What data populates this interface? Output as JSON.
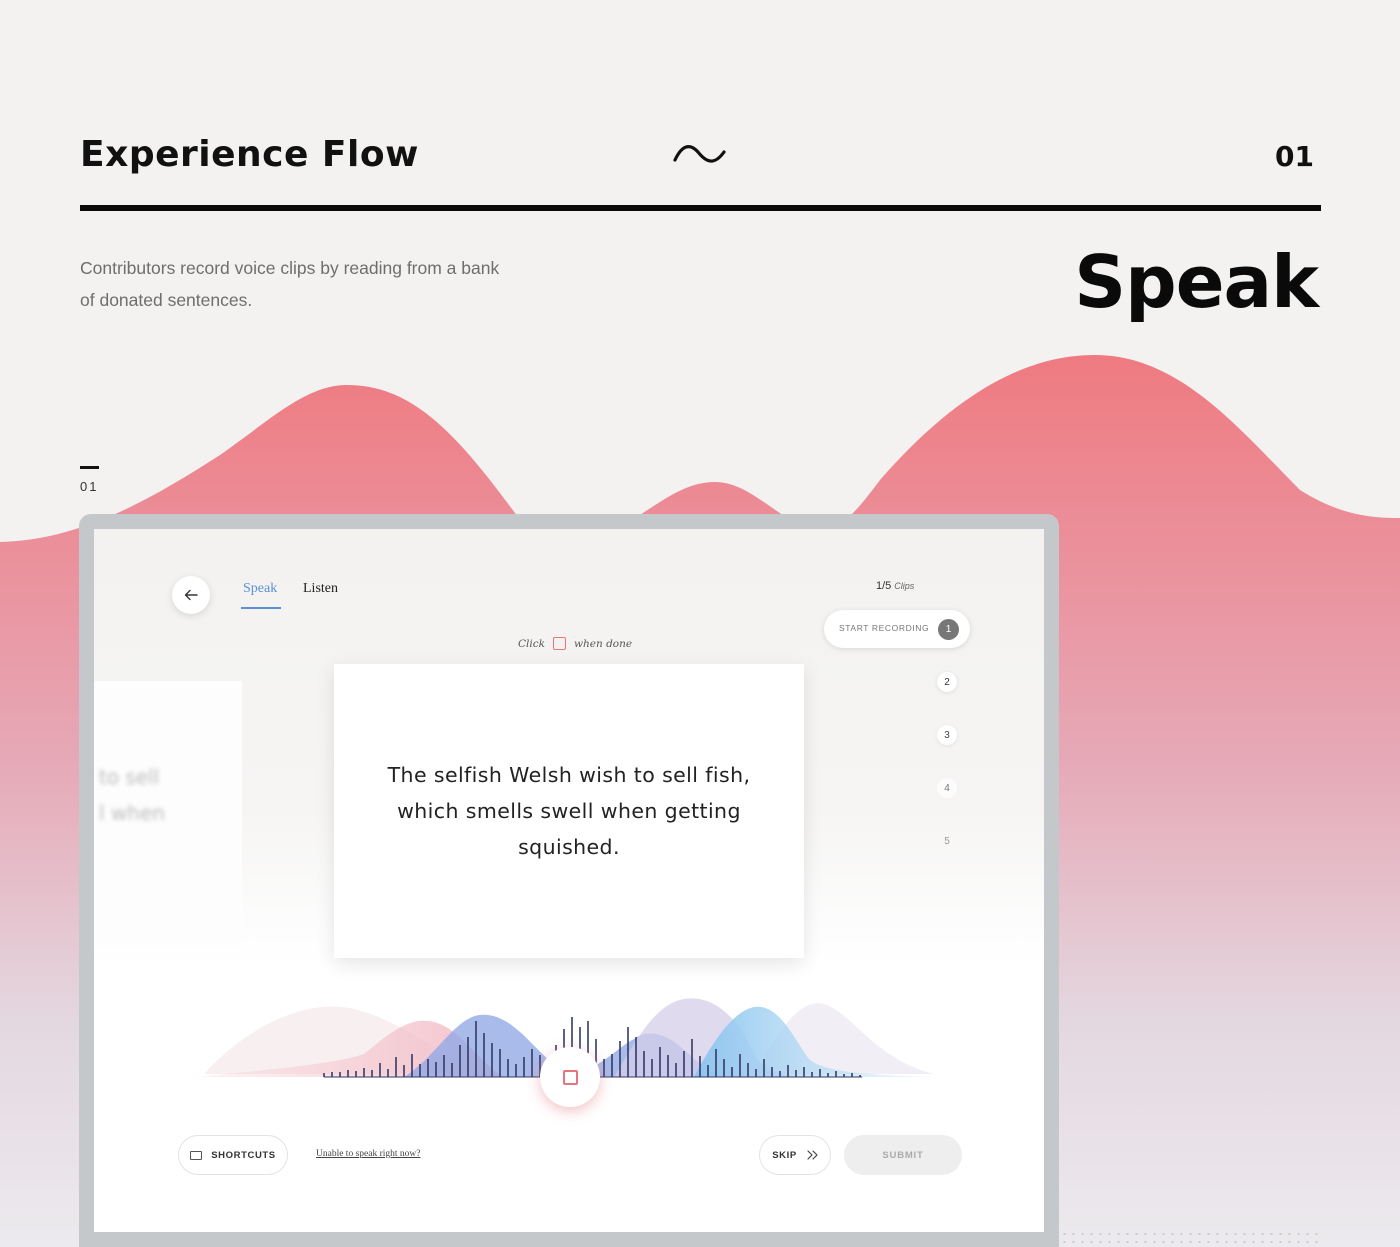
{
  "header": {
    "title": "Experience Flow",
    "section_number": "01"
  },
  "description": "Contributors record voice clips by reading from a bank of donated sentences.",
  "section_title": "Speak",
  "step_label": "01",
  "colors": {
    "pink": "#ef7a81",
    "blue_accent": "#5b8fd8",
    "record_red": "#e5757f",
    "wave_blue": "#7fa3e3",
    "wave_cyan": "#7ccbee"
  },
  "app": {
    "back_icon": "arrow-left-icon",
    "tabs": [
      {
        "label": "Speak",
        "active": true
      },
      {
        "label": "Listen",
        "active": false
      }
    ],
    "clips": {
      "counter": "1/5",
      "word": "Clips"
    },
    "steps": [
      {
        "number": "1",
        "label": "START RECORDING"
      },
      {
        "number": "2"
      },
      {
        "number": "3"
      },
      {
        "number": "4"
      },
      {
        "number": "5"
      }
    ],
    "hint": {
      "before": "Click",
      "after": "when done"
    },
    "ghost_text": "to sell\nl when",
    "sentence": "The selfish Welsh wish to sell fish, which smells swell when getting squished.",
    "record_icon": "stop-square-icon",
    "shortcuts_label": "SHORTCUTS",
    "keyboard_icon": "keyboard-icon",
    "unable_link": "Unable to speak right now?",
    "skip_label": "SKIP",
    "skip_icon": "double-chevron-right-icon",
    "submit_label": "SUBMIT"
  }
}
